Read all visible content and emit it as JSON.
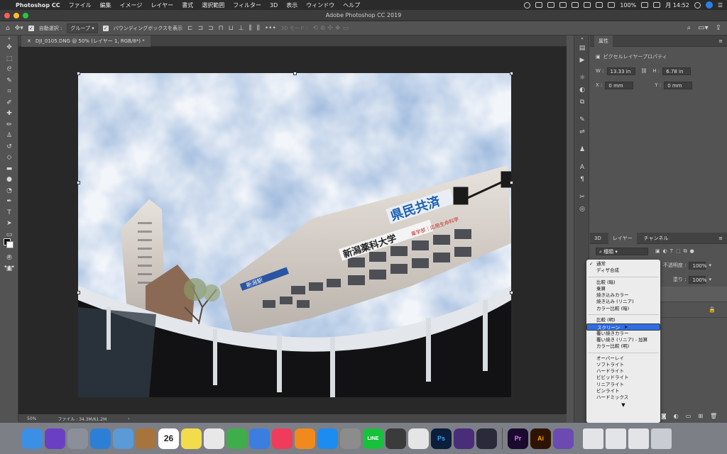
{
  "menubar": {
    "app_name": "Photoshop CC",
    "items": [
      "ファイル",
      "編集",
      "イメージ",
      "レイヤー",
      "書式",
      "選択範囲",
      "フィルター",
      "3D",
      "表示",
      "ウィンドウ",
      "ヘルプ"
    ],
    "battery": "100%",
    "clock": "月 14:52"
  },
  "window": {
    "title": "Adobe Photoshop CC 2019"
  },
  "options": {
    "auto_select_label": "自動選択 :",
    "auto_select_value": "グループ",
    "bounding_box_label": "バウンディングボックスを表示",
    "mode_3d_label": "3D モード :"
  },
  "document": {
    "tab_title": "DJI_0105.DNG @ 50% (レイヤー 1, RGB/8*) *",
    "zoom": "50%",
    "file_info": "ファイル : 34.3M/61.2M"
  },
  "properties": {
    "tab": "属性",
    "subtitle": "ピクセルレイヤープロパティ",
    "w_label": "W :",
    "w_value": "13.33 in",
    "h_label": "H :",
    "h_value": "6.78 in",
    "x_label": "X :",
    "x_value": "0 mm",
    "y_label": "Y :",
    "y_value": "0 mm"
  },
  "layers": {
    "tabs": [
      "3D",
      "レイヤー",
      "チャンネル"
    ],
    "kind_filter": "種類",
    "opacity_label": "不透明度 :",
    "opacity_value": "100%",
    "fill_label": "塗り :",
    "fill_value": "100%"
  },
  "blend_menu": {
    "groups": [
      [
        "通常",
        "ディザ合成"
      ],
      [
        "比較 (暗)",
        "乗算",
        "焼き込みカラー",
        "焼き込み (リニア)",
        "カラー比較 (暗)"
      ],
      [
        "比較 (明)",
        "スクリーン",
        "覆い焼きカラー",
        "覆い焼き (リニア) - 加算",
        "カラー比較 (明)"
      ],
      [
        "オーバーレイ",
        "ソフトライト",
        "ハードライト",
        "ビビッドライト",
        "リニアライト",
        "ピンライト",
        "ハードミックス"
      ]
    ],
    "checked": "通常",
    "highlighted": "スクリーン"
  },
  "canvas_signs": {
    "sign_1": "県民共済",
    "sign_2": "新潟薬科大学",
    "sign_3": "薬学部｜応用生命科学",
    "sign_4": "新潟駅"
  },
  "dock": {
    "apps": [
      {
        "name": "finder-app",
        "label": "",
        "color": "#3b8fe5"
      },
      {
        "name": "siri-app",
        "label": "",
        "color": "#6b3fc4"
      },
      {
        "name": "launchpad-app",
        "label": "",
        "color": "#8a8f99"
      },
      {
        "name": "safari-app",
        "label": "",
        "color": "#2d7fd6"
      },
      {
        "name": "preview-app",
        "label": "",
        "color": "#5a9ad6"
      },
      {
        "name": "notes-book-app",
        "label": "",
        "color": "#a7743e"
      },
      {
        "name": "calendar-app",
        "label": "26",
        "color": "#ffffff"
      },
      {
        "name": "stickies-app",
        "label": "",
        "color": "#f3dc4b"
      },
      {
        "name": "keynote-app",
        "label": "",
        "color": "#e8e8e8"
      },
      {
        "name": "numbers-app",
        "label": "",
        "color": "#3fae4a"
      },
      {
        "name": "keynote-2-app",
        "label": "",
        "color": "#3a7fe0"
      },
      {
        "name": "music-app",
        "label": "",
        "color": "#f03c5c"
      },
      {
        "name": "books-app",
        "label": "",
        "color": "#f08a1c"
      },
      {
        "name": "appstore-app",
        "label": "",
        "color": "#1c8cf0"
      },
      {
        "name": "system-prefs-app",
        "label": "",
        "color": "#8c8c8c"
      },
      {
        "name": "line-app",
        "label": "LINE",
        "color": "#16c23c"
      },
      {
        "name": "quicktime-app",
        "label": "",
        "color": "#3b3b3b"
      },
      {
        "name": "chrome-app",
        "label": "",
        "color": "#e5e5e5"
      },
      {
        "name": "photoshop-app",
        "label": "Ps",
        "color": "#0b1e3a"
      },
      {
        "name": "vegas-app",
        "label": "",
        "color": "#4a2d7a"
      },
      {
        "name": "bull-app",
        "label": "",
        "color": "#2a2a3a"
      },
      {
        "name": "premiere-app",
        "label": "Pr",
        "color": "#1a0a2e"
      },
      {
        "name": "illustrator-app",
        "label": "Ai",
        "color": "#2e1400"
      },
      {
        "name": "filmstrip-app",
        "label": "",
        "color": "#6c4ab2"
      }
    ]
  }
}
